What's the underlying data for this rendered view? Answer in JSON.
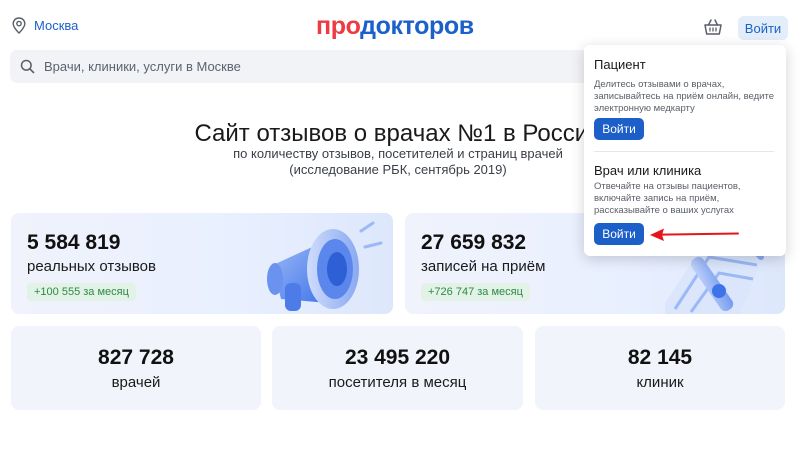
{
  "header": {
    "city": "Москва",
    "logo_pro": "про",
    "logo_doctors": "докторов",
    "login_label": "Войти",
    "icons": {
      "city": "location-pin-icon",
      "cart": "basket-icon",
      "search": "search-icon"
    }
  },
  "search": {
    "placeholder": "Врачи, клиники, услуги в Москве"
  },
  "hero": {
    "title": "Сайт отзывов о врачах №1 в России",
    "subtitle_line1": "по количеству отзывов, посетителей и страниц врачей",
    "subtitle_line2": "(исследование РБК, сентябрь 2019)"
  },
  "stats": {
    "reviews": {
      "value": "5 584 819",
      "label": "реальных отзывов",
      "delta": "+100 555 за месяц"
    },
    "appointments": {
      "value": "27 659 832",
      "label": "записей на приём",
      "delta": "+726 747 за месяц"
    },
    "doctors": {
      "value": "827 728",
      "label": "врачей"
    },
    "visitors": {
      "value": "23 495 220",
      "label": "посетителя в месяц"
    },
    "clinics": {
      "value": "82 145",
      "label": "клиник"
    }
  },
  "login_menu": {
    "patient": {
      "title": "Пациент",
      "description": "Делитесь отзывами о врачах, записывайтесь на приём онлайн, ведите электронную медкарту",
      "button": "Войти"
    },
    "doctor": {
      "title": "Врач или клиника",
      "description": "Отвечайте на отзывы пациентов, включайте запись на приём, рассказывайте о ваших услугах",
      "button": "Войти"
    }
  },
  "colors": {
    "brand_blue": "#1c61c9",
    "brand_red": "#ee3a43",
    "badge_green": "#2d8a47",
    "annotation_red": "#e8131b"
  }
}
